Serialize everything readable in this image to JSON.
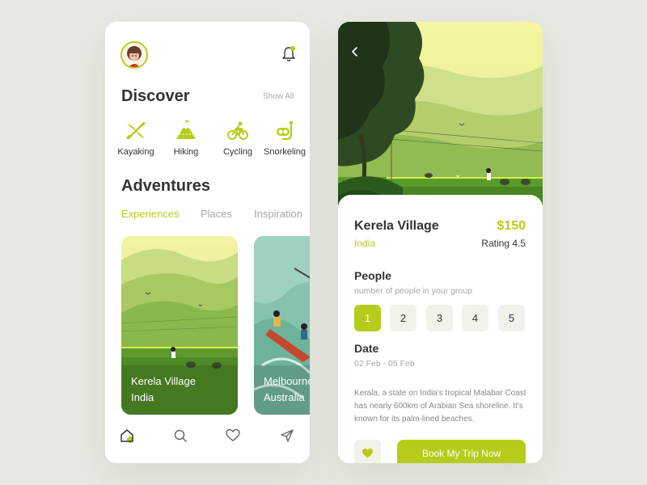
{
  "colors": {
    "accent": "#b7cc1a",
    "background": "#e6e8e1",
    "card": "#ffffff",
    "muted": "#a8a8a8",
    "text": "#333333"
  },
  "discover": {
    "title": "Discover",
    "show_all_label": "Show All",
    "categories": [
      {
        "label": "Kayaking",
        "icon": "kayak-icon"
      },
      {
        "label": "Hiking",
        "icon": "mountain-icon"
      },
      {
        "label": "Cycling",
        "icon": "bicycle-icon"
      },
      {
        "label": "Snorkeling",
        "icon": "snorkel-icon"
      }
    ]
  },
  "adventures": {
    "title": "Adventures",
    "tabs": [
      {
        "label": "Experiences",
        "active": true
      },
      {
        "label": "Places",
        "active": false
      },
      {
        "label": "Inspiration",
        "active": false
      }
    ],
    "cards": [
      {
        "title": "Kerela Village",
        "subtitle": "India"
      },
      {
        "title": "Melbourne",
        "subtitle": "Australia"
      }
    ]
  },
  "bottom_nav": [
    "home-icon",
    "search-icon",
    "heart-icon",
    "send-icon"
  ],
  "detail": {
    "name": "Kerela Village",
    "price": "$150",
    "country": "India",
    "rating": "Rating 4.5",
    "people_title": "People",
    "people_subtitle": "number of people in your group",
    "people_options": [
      "1",
      "2",
      "3",
      "4",
      "5"
    ],
    "selected_people": "1",
    "date_title": "Date",
    "date_range": "02 Feb - 05 Feb",
    "description": "Kerala, a state on India's tropical Malabar Coast has nearly 600km of Arabian Sea shoreline. It's known for its palm-lined beaches.",
    "book_label": "Book My Trip Now"
  }
}
